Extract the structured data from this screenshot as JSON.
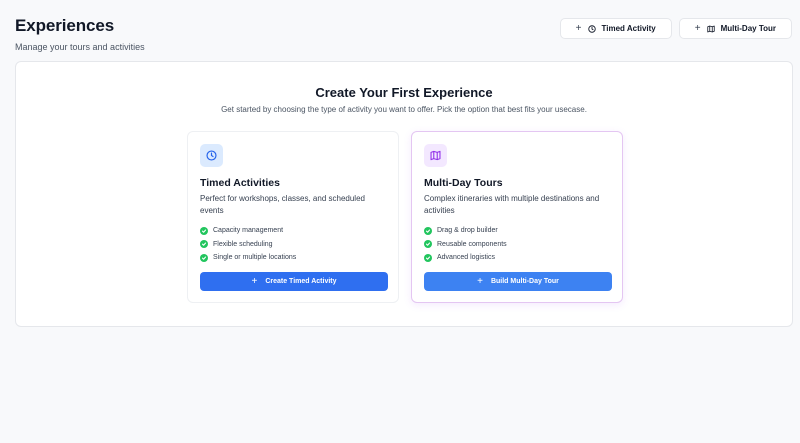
{
  "header": {
    "title": "Experiences",
    "subtitle": "Manage your tours and activities"
  },
  "actions": {
    "timed_label": "Timed Activity",
    "multi_label": "Multi-Day Tour"
  },
  "main": {
    "heading": "Create Your First Experience",
    "description": "Get started by choosing the type of activity you want to offer. Pick the option that best fits your usecase.",
    "cards": [
      {
        "icon": "clock-icon",
        "title": "Timed Activities",
        "description": "Perfect for workshops, classes, and scheduled events",
        "features": [
          "Capacity management",
          "Flexible scheduling",
          "Single or multiple locations"
        ],
        "button": "Create Timed Activity"
      },
      {
        "icon": "map-icon",
        "title": "Multi-Day Tours",
        "description": "Complex itineraries with multiple destinations and activities",
        "features": [
          "Drag & drop builder",
          "Reusable components",
          "Advanced logistics"
        ],
        "button": "Build Multi-Day Tour"
      }
    ]
  },
  "colors": {
    "primary": "#2f6ff0",
    "success": "#22c55e",
    "timed_icon_bg": "#dbeafe",
    "multi_icon_bg": "#f3e8ff",
    "multi_border": "#e4c6f2"
  }
}
